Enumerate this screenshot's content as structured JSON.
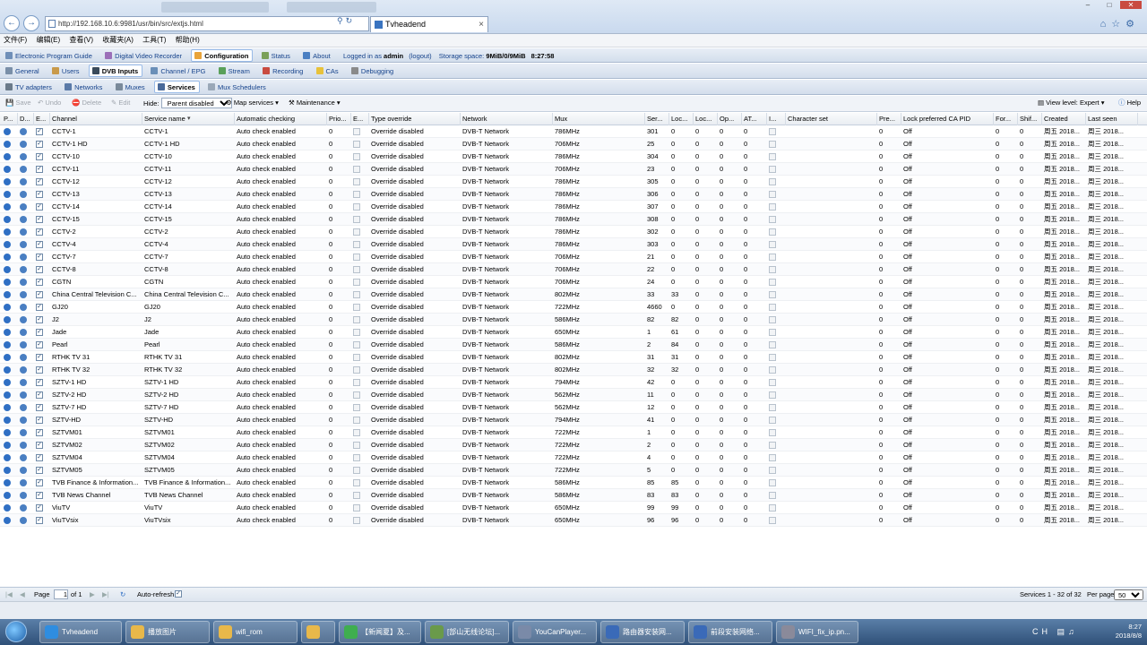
{
  "browser": {
    "url": "http://192.168.10.6:9981/usr/bin/src/extjs.html",
    "tab_title": "Tvheadend",
    "menu": [
      "文件(F)",
      "编辑(E)",
      "查看(V)",
      "收藏夹(A)",
      "工具(T)",
      "帮助(H)"
    ]
  },
  "top_tabs": [
    {
      "label": "Electronic Program Guide",
      "color": "#6f8fb8"
    },
    {
      "label": "Digital Video Recorder",
      "color": "#9b6fb8"
    },
    {
      "label": "Configuration",
      "color": "#e8a33a",
      "active": true
    },
    {
      "label": "Status",
      "color": "#7aa05a"
    },
    {
      "label": "About",
      "color": "#4a7fc2"
    }
  ],
  "session": {
    "logged_prefix": "Logged in as",
    "user": "admin",
    "logout": "(logout)",
    "storage_label": "Storage space:",
    "storage_value": "9MiB/0/9MiB",
    "time": "8:27:58"
  },
  "config_tabs": [
    {
      "label": "General",
      "color": "#7a8fa8"
    },
    {
      "label": "Users",
      "color": "#c99a4a"
    },
    {
      "label": "DVB Inputs",
      "color": "#3a4a5a",
      "active": true
    },
    {
      "label": "Channel / EPG",
      "color": "#6a8fb8"
    },
    {
      "label": "Stream",
      "color": "#5aa05a"
    },
    {
      "label": "Recording",
      "color": "#c94b40"
    },
    {
      "label": "CAs",
      "color": "#e8c23a"
    },
    {
      "label": "Debugging",
      "color": "#8a8a8a"
    }
  ],
  "dvb_tabs": [
    {
      "label": "TV adapters",
      "color": "#6a7a8a"
    },
    {
      "label": "Networks",
      "color": "#5a7aa8"
    },
    {
      "label": "Muxes",
      "color": "#7a8a9a"
    },
    {
      "label": "Services",
      "color": "#4a6a9a",
      "active": true
    },
    {
      "label": "Mux Schedulers",
      "color": "#9aa8b8"
    }
  ],
  "grid_toolbar": {
    "save": "Save",
    "undo": "Undo",
    "delete": "Delete",
    "edit": "Edit",
    "hide_label": "Hide:",
    "hide_value": "Parent disabled",
    "map_services": "Map services",
    "maintenance": "Maintenance",
    "view_level": "View level: Expert",
    "help": "Help"
  },
  "columns": [
    "P...",
    "D...",
    "E...",
    "Channel",
    "Service name",
    "Automatic checking",
    "Prio...",
    "E...",
    "Type override",
    "Network",
    "Mux",
    "Ser...",
    "Loc...",
    "Loc...",
    "Op...",
    "AT...",
    "I...",
    "Character set",
    "Pre...",
    "Lock preferred CA PID",
    "For...",
    "Shif...",
    "Created",
    "Last seen"
  ],
  "rows": [
    [
      "CCTV-1",
      "CCTV-1",
      "786MHz",
      "301",
      "0",
      "0"
    ],
    [
      "CCTV-1 HD",
      "CCTV-1 HD",
      "706MHz",
      "25",
      "0",
      "0"
    ],
    [
      "CCTV-10",
      "CCTV-10",
      "786MHz",
      "304",
      "0",
      "0"
    ],
    [
      "CCTV-11",
      "CCTV-11",
      "706MHz",
      "23",
      "0",
      "0"
    ],
    [
      "CCTV-12",
      "CCTV-12",
      "786MHz",
      "305",
      "0",
      "0"
    ],
    [
      "CCTV-13",
      "CCTV-13",
      "786MHz",
      "306",
      "0",
      "0"
    ],
    [
      "CCTV-14",
      "CCTV-14",
      "786MHz",
      "307",
      "0",
      "0"
    ],
    [
      "CCTV-15",
      "CCTV-15",
      "786MHz",
      "308",
      "0",
      "0"
    ],
    [
      "CCTV-2",
      "CCTV-2",
      "786MHz",
      "302",
      "0",
      "0"
    ],
    [
      "CCTV-4",
      "CCTV-4",
      "786MHz",
      "303",
      "0",
      "0"
    ],
    [
      "CCTV-7",
      "CCTV-7",
      "706MHz",
      "21",
      "0",
      "0"
    ],
    [
      "CCTV-8",
      "CCTV-8",
      "706MHz",
      "22",
      "0",
      "0"
    ],
    [
      "CGTN",
      "CGTN",
      "706MHz",
      "24",
      "0",
      "0"
    ],
    [
      "China Central Television C...",
      "China Central Television C...",
      "802MHz",
      "33",
      "33",
      "0"
    ],
    [
      "GJ20",
      "GJ20",
      "722MHz",
      "4660",
      "0",
      "0"
    ],
    [
      "J2",
      "J2",
      "586MHz",
      "82",
      "82",
      "0"
    ],
    [
      "Jade",
      "Jade",
      "650MHz",
      "1",
      "61",
      "0"
    ],
    [
      "Pearl",
      "Pearl",
      "586MHz",
      "2",
      "84",
      "0"
    ],
    [
      "RTHK TV 31",
      "RTHK TV 31",
      "802MHz",
      "31",
      "31",
      "0"
    ],
    [
      "RTHK TV 32",
      "RTHK TV 32",
      "802MHz",
      "32",
      "32",
      "0"
    ],
    [
      "SZTV-1 HD",
      "SZTV-1 HD",
      "794MHz",
      "42",
      "0",
      "0"
    ],
    [
      "SZTV-2 HD",
      "SZTV-2 HD",
      "562MHz",
      "11",
      "0",
      "0"
    ],
    [
      "SZTV-7 HD",
      "SZTV-7 HD",
      "562MHz",
      "12",
      "0",
      "0"
    ],
    [
      "SZTV-HD",
      "SZTV-HD",
      "794MHz",
      "41",
      "0",
      "0"
    ],
    [
      "SZTVM01",
      "SZTVM01",
      "722MHz",
      "1",
      "0",
      "0"
    ],
    [
      "SZTVM02",
      "SZTVM02",
      "722MHz",
      "2",
      "0",
      "0"
    ],
    [
      "SZTVM04",
      "SZTVM04",
      "722MHz",
      "4",
      "0",
      "0"
    ],
    [
      "SZTVM05",
      "SZTVM05",
      "722MHz",
      "5",
      "0",
      "0"
    ],
    [
      "TVB Finance & Information...",
      "TVB Finance & Information...",
      "586MHz",
      "85",
      "85",
      "0"
    ],
    [
      "TVB News Channel",
      "TVB News Channel",
      "586MHz",
      "83",
      "83",
      "0"
    ],
    [
      "ViuTV",
      "ViuTV",
      "650MHz",
      "99",
      "99",
      "0"
    ],
    [
      "ViuTVsix",
      "ViuTVsix",
      "650MHz",
      "96",
      "96",
      "0"
    ]
  ],
  "row_common": {
    "auto_check": "Auto check enabled",
    "prio": "0",
    "type_override": "Override disabled",
    "network": "DVB-T Network",
    "zero": "0",
    "lock_pref": "Off",
    "created": "周五 2018...",
    "last_seen": "周三 2018..."
  },
  "pager": {
    "page_label": "Page",
    "page_value": "1",
    "of_label": "of 1",
    "auto_refresh": "Auto-refresh",
    "summary": "Services 1 - 32 of 32",
    "per_page_label": "Per page",
    "per_page_value": "50"
  },
  "taskbar": {
    "items": [
      {
        "label": "Tvheadend",
        "color": "#2f8de0"
      },
      {
        "label": "播放图片",
        "color": "#e8b84a"
      },
      {
        "label": "wifi_rom",
        "color": "#e8b84a"
      },
      {
        "label": "",
        "color": "#e8b84a"
      },
      {
        "label": "【新闻夏】及...",
        "color": "#3fae4f"
      },
      {
        "label": "[部山无线论坛]...",
        "color": "#6a9a4a"
      },
      {
        "label": "YouCanPlayer...",
        "color": "#7a8aa8"
      },
      {
        "label": "路由器安装网...",
        "color": "#3a6ab8"
      },
      {
        "label": "前段安装网络...",
        "color": "#3a6ab8"
      },
      {
        "label": "WIFI_fix_ip.pn...",
        "color": "#8a8a9a"
      }
    ],
    "time": "8:27",
    "date": "2018/8/8",
    "tray_text": "CH"
  }
}
